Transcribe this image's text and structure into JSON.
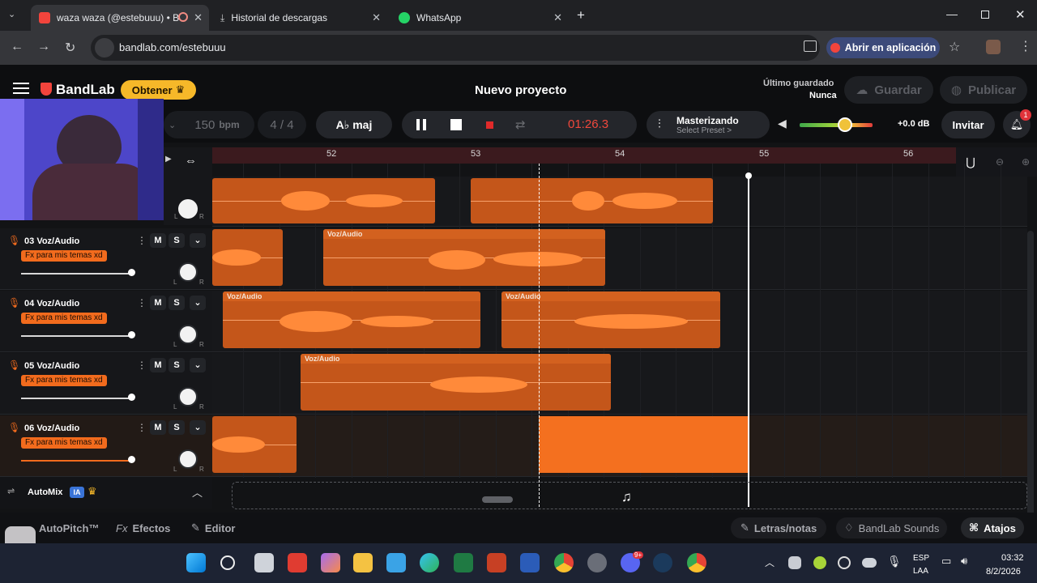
{
  "browser": {
    "tabs": [
      {
        "title": "waza waza (@estebuuu) • B",
        "active": true
      },
      {
        "title": "Historial de descargas",
        "active": false
      },
      {
        "title": "WhatsApp",
        "active": false
      }
    ],
    "url": "bandlab.com/estebuuu",
    "open_app_label": "Abrir en aplicación"
  },
  "app": {
    "brand": "BandLab",
    "obtain_label": "Obtener",
    "project_title": "Nuevo proyecto",
    "last_saved_label": "Último guardado",
    "last_saved_value": "Nunca",
    "save_label": "Guardar",
    "publish_label": "Publicar",
    "bpm_value": "150",
    "bpm_unit": "bpm",
    "time_signature": "4 / 4",
    "key": "A♭ maj",
    "time_display": "01:26.3",
    "mastering_label": "Masterizando",
    "preset_label": "Select Preset >",
    "master_volume": "+0.0 dB",
    "master_volume_level": 0.62,
    "invite_label": "Invitar",
    "notification_count": "1"
  },
  "ruler": {
    "bars": [
      "52",
      "53",
      "54",
      "55",
      "56"
    ]
  },
  "tracks": [
    {
      "number": "03",
      "name": "Voz/Audio",
      "fx": "Fx para mis temas xd",
      "mute": "M",
      "solo": "S"
    },
    {
      "number": "04",
      "name": "Voz/Audio",
      "fx": "Fx para mis temas xd",
      "mute": "M",
      "solo": "S"
    },
    {
      "number": "05",
      "name": "Voz/Audio",
      "fx": "Fx para mis temas xd",
      "mute": "M",
      "solo": "S"
    },
    {
      "number": "06",
      "name": "Voz/Audio",
      "fx": "Fx para mis temas xd",
      "mute": "M",
      "solo": "S"
    }
  ],
  "clip_label": "Voz/Audio",
  "pan_labels": {
    "left": "L",
    "right": "R"
  },
  "automix": {
    "label": "AutoMix",
    "badge": "IA"
  },
  "bottom": {
    "autopitch": "AutoPitch™",
    "effects_prefix": "Fx",
    "effects": "Efectos",
    "editor": "Editor",
    "lyrics": "Letras/notas",
    "sounds": "BandLab Sounds",
    "shortcuts": "Atajos"
  },
  "taskbar": {
    "lang_top": "ESP",
    "lang_bottom": "LAA",
    "time": "03:32",
    "date": "8/2/2026",
    "discord_badge": "9+"
  }
}
